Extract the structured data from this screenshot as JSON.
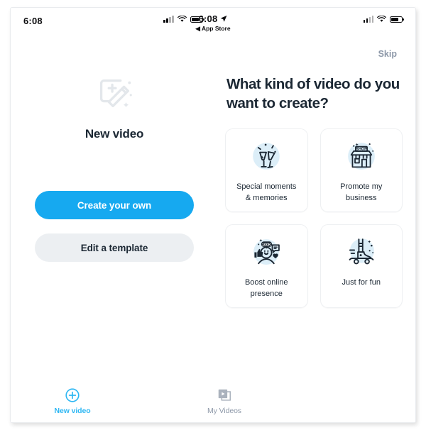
{
  "colors": {
    "accent": "#16a9f0",
    "tab_active": "#2eb7f3",
    "text_dark": "#1b2733",
    "text_muted": "#8e99a9",
    "secondary_button_bg": "#eceff2",
    "icon_circle_bg": "#dceef8",
    "card_border": "#eef0f2"
  },
  "status_bar": {
    "left_time": "6:08",
    "center_time": "6:08",
    "center_back_label": "◀ App Store",
    "location_icon": "location-arrow-icon",
    "signal_icon": "cellular-signal-icon",
    "wifi_icon": "wifi-icon",
    "battery_icon": "battery-icon"
  },
  "left_pane": {
    "hero_icon": "new-video-magic-wand-icon",
    "hero_title": "New video",
    "primary_button": "Create your own",
    "secondary_button": "Edit a template"
  },
  "right_pane": {
    "skip_label": "Skip",
    "question_title": "What kind of video do you want to create?",
    "cards": [
      {
        "label": "Special moments\n& memories",
        "icon": "champagne-toast-icon"
      },
      {
        "label": "Promote my\nbusiness",
        "icon": "storefront-shop-icon",
        "sign_text": "SHOP"
      },
      {
        "label": "Boost online\npresence",
        "icon": "social-engagement-icon",
        "badge_text": "100K"
      },
      {
        "label": "Just for fun",
        "icon": "skateboard-sneaker-icon"
      }
    ]
  },
  "tab_bar": {
    "tabs": [
      {
        "label": "New video",
        "icon": "plus-circle-icon",
        "active": true
      },
      {
        "label": "My Videos",
        "icon": "video-library-icon",
        "active": false
      }
    ]
  }
}
